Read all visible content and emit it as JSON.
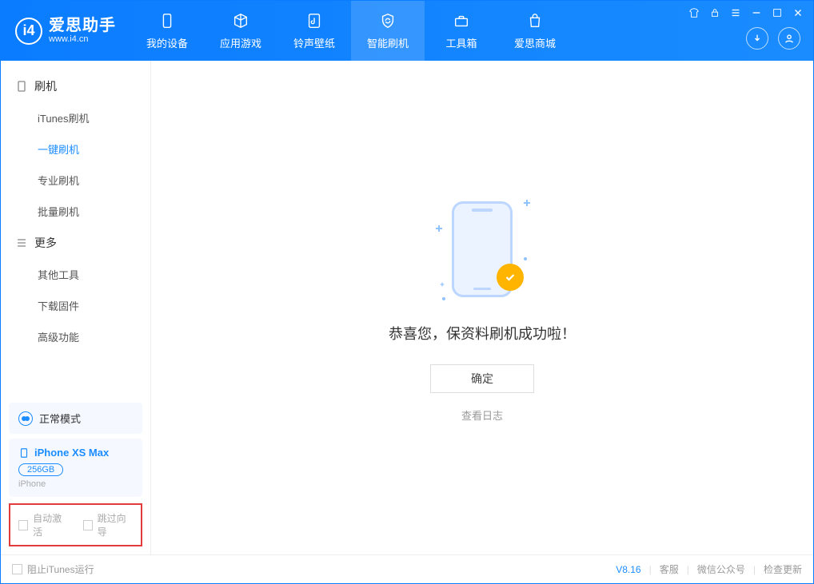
{
  "app": {
    "name_cn": "爱思助手",
    "name_en": "www.i4.cn"
  },
  "nav": {
    "items": [
      {
        "label": "我的设备"
      },
      {
        "label": "应用游戏"
      },
      {
        "label": "铃声壁纸"
      },
      {
        "label": "智能刷机"
      },
      {
        "label": "工具箱"
      },
      {
        "label": "爱思商城"
      }
    ]
  },
  "sidebar": {
    "group1": {
      "title": "刷机",
      "items": [
        "iTunes刷机",
        "一键刷机",
        "专业刷机",
        "批量刷机"
      ]
    },
    "group2": {
      "title": "更多",
      "items": [
        "其他工具",
        "下载固件",
        "高级功能"
      ]
    },
    "mode_label": "正常模式",
    "device": {
      "name": "iPhone XS Max",
      "storage": "256GB",
      "type": "iPhone"
    },
    "redbox": {
      "auto_activate": "自动激活",
      "skip_guide": "跳过向导"
    }
  },
  "main": {
    "success_text": "恭喜您，保资料刷机成功啦！",
    "ok_button": "确定",
    "log_link": "查看日志"
  },
  "footer": {
    "block_itunes": "阻止iTunes运行",
    "version": "V8.16",
    "links": [
      "客服",
      "微信公众号",
      "检查更新"
    ]
  }
}
